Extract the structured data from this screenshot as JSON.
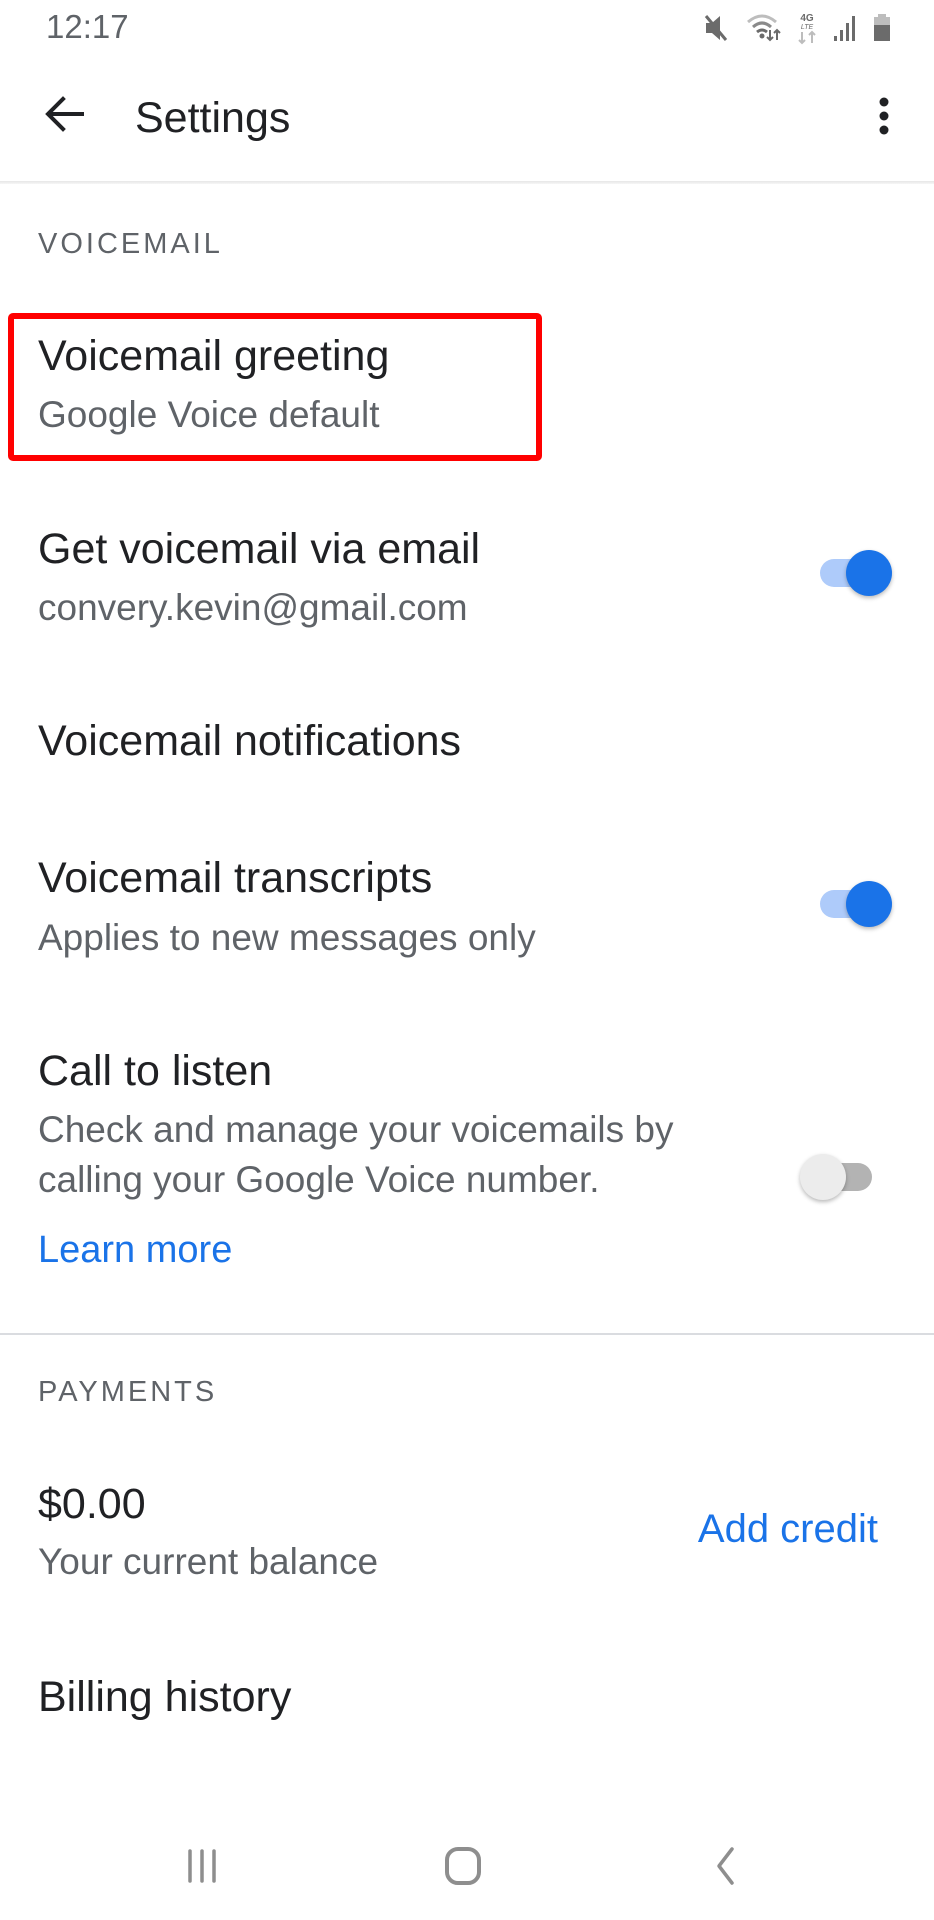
{
  "status_bar": {
    "time": "12:17",
    "icons": [
      "mute-icon",
      "wifi-icon",
      "4g-lte-icon",
      "signal-icon",
      "battery-icon"
    ],
    "network_label_top": "4G",
    "network_label_bottom": "LTE"
  },
  "app_bar": {
    "title": "Settings",
    "back_icon": "arrow-back-icon",
    "menu_icon": "more-vert-icon"
  },
  "sections": {
    "voicemail": {
      "header": "VOICEMAIL",
      "items": [
        {
          "title": "Voicemail greeting",
          "subtitle": "Google Voice default",
          "highlighted": true
        },
        {
          "title": "Get voicemail via email",
          "subtitle": "convery.kevin@gmail.com",
          "toggle": true
        },
        {
          "title": "Voicemail notifications"
        },
        {
          "title": "Voicemail transcripts",
          "subtitle": "Applies to new messages only",
          "toggle": true
        },
        {
          "title": "Call to listen",
          "subtitle_lines": [
            "Check and manage your voicemails by",
            "calling your Google Voice number."
          ],
          "link": "Learn more",
          "toggle": false
        }
      ]
    },
    "payments": {
      "header": "PAYMENTS",
      "balance": {
        "amount": "$0.00",
        "label": "Your current balance",
        "action": "Add credit"
      },
      "billing_history": "Billing history"
    }
  },
  "nav_bar": {
    "buttons": [
      "recent-apps-icon",
      "home-icon",
      "back-icon"
    ]
  },
  "colors": {
    "accent": "#1a73e8",
    "accent_track": "#aecbfa",
    "highlight": "#ff0000",
    "primary_text": "#202124",
    "secondary_text": "#5f6368"
  }
}
